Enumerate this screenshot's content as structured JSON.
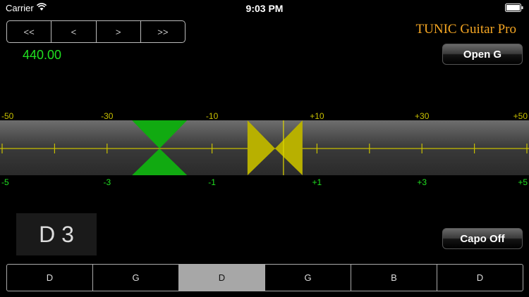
{
  "status": {
    "carrier": "Carrier",
    "time": "9:03 PM"
  },
  "nav": {
    "first": "<<",
    "prev": "<",
    "next": ">",
    "last": ">>"
  },
  "frequency": "440.00",
  "brand": "TUNIC Guitar Pro",
  "tuning_button": "Open G",
  "capo_button": "Capo Off",
  "note": "D 3",
  "meter": {
    "top_labels": [
      "-50",
      "-30",
      "-10",
      "+10",
      "+30",
      "+50"
    ],
    "bottom_labels": [
      "-5",
      "-3",
      "-1",
      "+1",
      "+3",
      "+5"
    ],
    "reference_cents": -20,
    "detected_cents": 2
  },
  "strings": [
    "D",
    "G",
    "D",
    "G",
    "B",
    "D"
  ],
  "selected_string": 2,
  "colors": {
    "green": "#20e020",
    "yellow": "#c8c000",
    "orange": "#f5a623",
    "selected": "#a7a7a7"
  }
}
